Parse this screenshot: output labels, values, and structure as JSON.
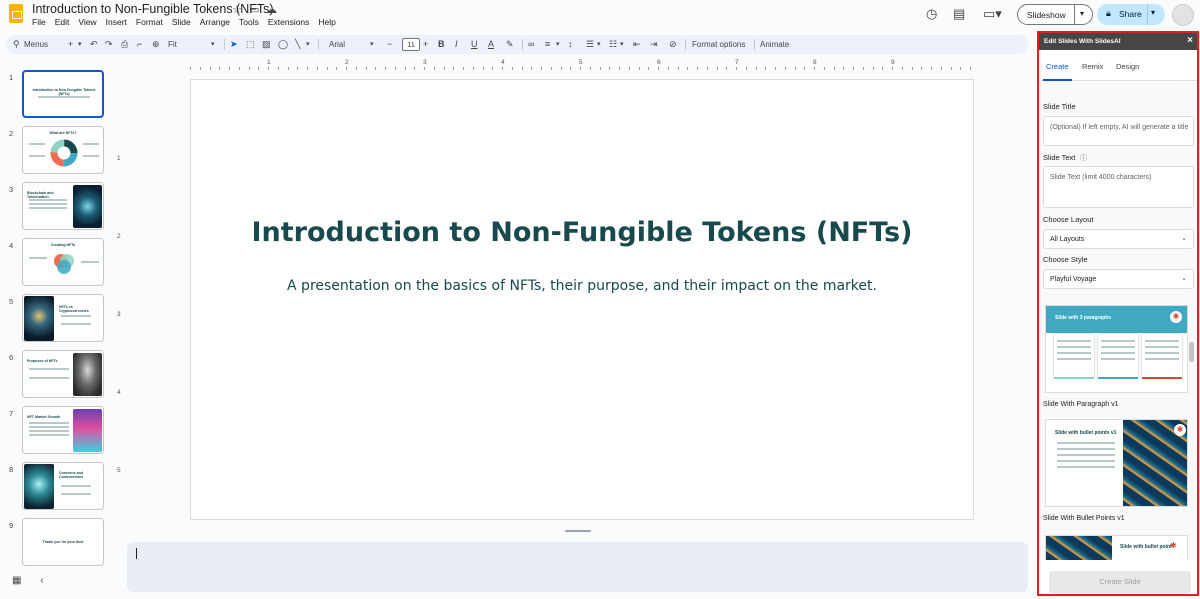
{
  "app": {
    "doc_title": "Introduction to Non-Fungible Tokens (NFTs)",
    "menu": [
      "File",
      "Edit",
      "View",
      "Insert",
      "Format",
      "Slide",
      "Arrange",
      "Tools",
      "Extensions",
      "Help"
    ],
    "slideshow_label": "Slideshow",
    "share_label": "Share"
  },
  "toolbar": {
    "menus_label": "Menus",
    "zoom_label": "Fit",
    "font_label": "Arial",
    "font_size": "11",
    "format_options_label": "Format options",
    "animate_label": "Animate"
  },
  "ruler": {
    "h_numbers": [
      "1",
      "1",
      "2",
      "3",
      "4",
      "5",
      "6",
      "7",
      "8",
      "9"
    ],
    "v_numbers": [
      "1",
      "2",
      "3",
      "4",
      "5"
    ]
  },
  "filmstrip": [
    {
      "num": "1",
      "title": "Introduction to Non-Fungible Tokens (NFTs)",
      "selected": true
    },
    {
      "num": "2",
      "title": "What are NFTs?"
    },
    {
      "num": "3",
      "title": "Blockchain and Tokenization"
    },
    {
      "num": "4",
      "title": "Creating NFTs"
    },
    {
      "num": "5",
      "title": "NFTs vs Cryptocurrencies"
    },
    {
      "num": "6",
      "title": "Purposes of NFTs"
    },
    {
      "num": "7",
      "title": "NFT Market Growth"
    },
    {
      "num": "8",
      "title": "Concerns and Controversies"
    },
    {
      "num": "9",
      "title": "Thank you for your time"
    }
  ],
  "slide": {
    "title": "Introduction to Non-Fungible Tokens (NFTs)",
    "subtitle": "A presentation on the basics of NFTs, their purpose, and their impact on the market."
  },
  "sidepanel": {
    "header": "Edit Slides With SlidesAI",
    "tabs": [
      "Create",
      "Remix",
      "Design"
    ],
    "slide_title_label": "Slide Title",
    "slide_title_placeholder": "(Optional) If left empty, AI will generate a title",
    "slide_text_label": "Slide Text",
    "slide_text_placeholder": "Slide Text (limit 4000 characters)",
    "layout_label": "Choose Layout",
    "layout_value": "All Layouts",
    "style_label": "Choose Style",
    "style_value": "Playful Voyage",
    "preview1_heading": "Slide with 3 paragraphs",
    "preview1_caption": "Slide With Paragraph v1",
    "preview2_heading": "Slide with bullet points v1",
    "preview2_caption": "Slide With Bullet Points v1",
    "preview3_heading": "Slide with bullet point",
    "create_button": "Create Slide"
  },
  "colors": {
    "accent": "#0b57d0",
    "slide_text": "#17494d",
    "panel_highlight": "#e02020",
    "preview_teal": "#3fa9c2"
  }
}
